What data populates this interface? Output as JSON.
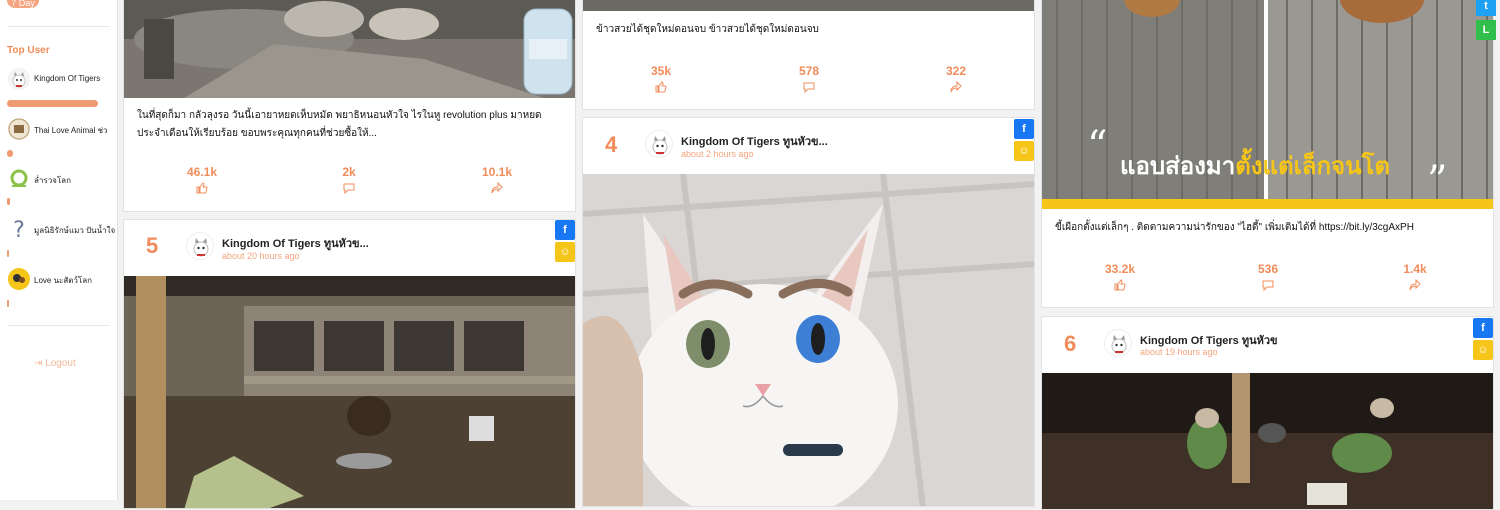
{
  "sidebar": {
    "pill_label": "7 Day",
    "top_user_title": "Top User",
    "users": [
      {
        "name": "Kingdom Of Tigers"
      },
      {
        "name": "Thai Love Animal ช่ว"
      },
      {
        "name": "ล่ำรวจโลก"
      },
      {
        "name": "มูลนิธิรักษ์แมว ปันน้ำใจ"
      },
      {
        "name": "Love นะสัตว์โลก"
      }
    ],
    "logout_label": "Logout"
  },
  "col1": {
    "card_a": {
      "text": "ในที่สุดก็มา กลัวลุงรอ วันนี้เอายาหยดเห็บหมัด พยาธิหนอนหัวใจ ไรในหู revolution plus มาหยดประจำเดือนให้เรียบร้อย ขอบพระคุณทุกคนที่ช่วยซื้อให้...",
      "likes": "46.1k",
      "comments": "2k",
      "shares": "10.1k"
    },
    "card_b": {
      "rank": "5",
      "author": "Kingdom Of Tigers ทูนหัวข...",
      "time": "about 20 hours ago"
    }
  },
  "col2": {
    "card_a": {
      "text": "ข้าวสวยได้ชุดใหม่ดอนจบ ข้าวสวยได้ชุดใหม่ดอนจบ",
      "likes": "35k",
      "comments": "578",
      "shares": "322"
    },
    "card_b": {
      "rank": "4",
      "author": "Kingdom Of Tigers ทูนหัวข...",
      "time": "about 2 hours ago"
    }
  },
  "col3": {
    "card_a": {
      "banner_text_white": "แอบส่องมา",
      "banner_text_yellow": "ตั้งแต่เล็กจนโต",
      "text": "ขี้เผือกตั้งแต่เล็กๆ . ติดตามความน่ารักของ \"ไฮดี้\" เพิ่มเติมได้ที่ https://bit.ly/3cgAxPH",
      "likes": "33.2k",
      "comments": "536",
      "shares": "1.4k"
    },
    "card_b": {
      "rank": "6",
      "author": "Kingdom Of Tigers ทูนหัวข",
      "time": "about 19 hours ago"
    }
  },
  "icons": {
    "facebook": "facebook-icon",
    "smile": "smile-icon",
    "twitter": "twitter-icon",
    "line": "line-icon",
    "like": "thumbs-up-icon",
    "comment": "comment-icon",
    "share": "share-icon",
    "logout": "logout-icon"
  },
  "colors": {
    "accent": "#f08c5a",
    "facebook": "#1877f2",
    "smile": "#f5c518",
    "twitter": "#1da1f2",
    "line": "#2fbf4a"
  }
}
